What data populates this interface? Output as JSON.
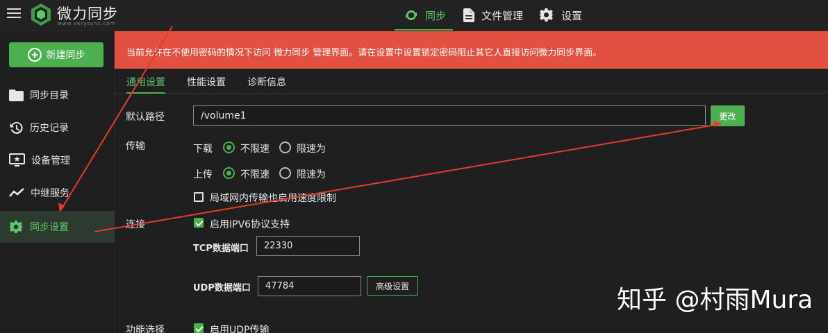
{
  "header": {
    "brand": "微力同步",
    "brand_sub": "www.verysync.com",
    "nav": [
      {
        "label": "同步"
      },
      {
        "label": "文件管理"
      },
      {
        "label": "设置"
      }
    ]
  },
  "sidebar": {
    "new_button": "新建同步",
    "items": [
      {
        "label": "同步目录"
      },
      {
        "label": "历史记录"
      },
      {
        "label": "设备管理"
      },
      {
        "label": "中继服务"
      },
      {
        "label": "同步设置"
      }
    ]
  },
  "banner": {
    "text": "当前允许在不使用密码的情况下访问 微力同步 管理界面。请在设置中设置锁定密码阻止其它人直接访问微力同步界面。"
  },
  "tabs": [
    "通用设置",
    "性能设置",
    "诊断信息"
  ],
  "settings": {
    "default_path": {
      "label": "默认路径",
      "value": "/volume1",
      "button": "更改"
    },
    "transfer": {
      "label": "传输",
      "download": {
        "label": "下载",
        "options": [
          "不限速",
          "限速为"
        ],
        "selected": "不限速"
      },
      "upload": {
        "label": "上传",
        "options": [
          "不限速",
          "限速为"
        ],
        "selected": "不限速"
      },
      "lan_limit": {
        "label": "局域网内传输也启用速度限制",
        "checked": false
      }
    },
    "connection": {
      "label": "连接",
      "ipv6": {
        "label": "启用IPV6协议支持",
        "checked": true
      },
      "tcp_port": {
        "label": "TCP数据端口",
        "value": "22330"
      },
      "udp_port": {
        "label": "UDP数据端口",
        "value": "47784"
      },
      "advanced_button": "高级设置"
    },
    "features": {
      "label": "功能选择",
      "udp": {
        "label": "启用UDP传输",
        "checked": true
      }
    }
  },
  "watermark": "知乎 @村雨Mura",
  "colors": {
    "accent": "#4caf50",
    "banner": "#e25041",
    "background": "#1f1f1f",
    "annotation": "#e53a2c"
  }
}
